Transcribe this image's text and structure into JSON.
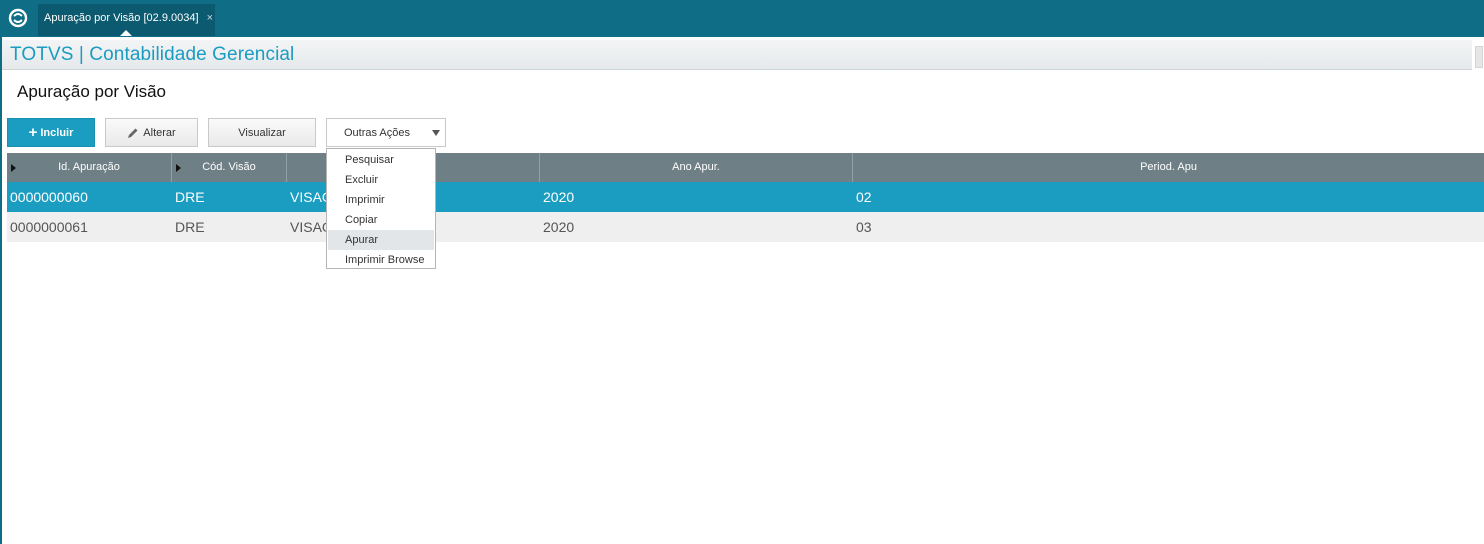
{
  "tabbar": {
    "tab_title": "Apuração por Visão [02.9.0034]",
    "close_glyph": "×"
  },
  "app": {
    "title": "TOTVS | Contabilidade Gerencial"
  },
  "page": {
    "title": "Apuração por Visão"
  },
  "toolbar": {
    "incluir_label": "Incluir",
    "alterar_label": "Alterar",
    "visualizar_label": "Visualizar",
    "outras_label": "Outras Ações"
  },
  "menu": {
    "items": [
      {
        "label": "Pesquisar",
        "hovered": false
      },
      {
        "label": "Excluir",
        "hovered": false
      },
      {
        "label": "Imprimir",
        "hovered": false
      },
      {
        "label": "Copiar",
        "hovered": false
      },
      {
        "label": "Apurar",
        "hovered": true
      },
      {
        "label": "Imprimir Browse",
        "hovered": false
      }
    ]
  },
  "grid": {
    "columns": [
      "Id. Apuração",
      "Cód. Visão",
      "",
      "Ano Apur.",
      "Period.  Apu"
    ],
    "rows": [
      {
        "id": "0000000060",
        "cod": "DRE",
        "visao": "VISAO",
        "ano": "2020",
        "periodo": "02",
        "selected": true
      },
      {
        "id": "0000000061",
        "cod": "DRE",
        "visao": "VISAO",
        "ano": "2020",
        "periodo": "03",
        "selected": false
      }
    ]
  },
  "colors": {
    "topbar": "#0f6d86",
    "accent": "#1b9dc1",
    "grid_header": "#6f7f86"
  },
  "icons": {
    "app_logo": "totvs-logo-icon",
    "alterar": "pencil-icon",
    "incluir": "plus-icon"
  }
}
